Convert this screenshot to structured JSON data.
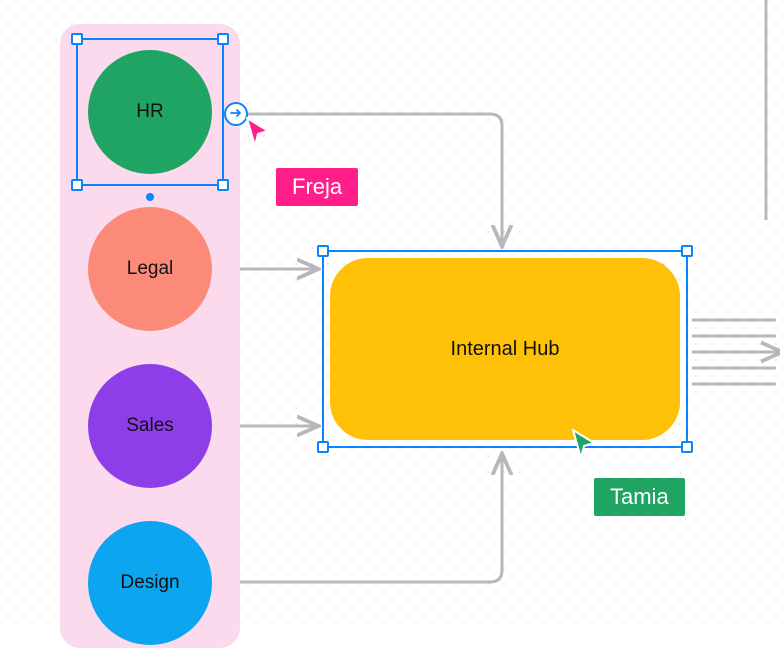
{
  "nodes": {
    "hr": {
      "label": "HR",
      "color": "#1FA463"
    },
    "legal": {
      "label": "Legal",
      "color": "#FC8A78"
    },
    "sales": {
      "label": "Sales",
      "color": "#8E3EE8"
    },
    "design": {
      "label": "Design",
      "color": "#0BA5F0"
    }
  },
  "hub": {
    "label": "Internal Hub",
    "color": "#FFC107"
  },
  "collaborators": {
    "freja": {
      "name": "Freja",
      "color": "#FF1E8A"
    },
    "tamia": {
      "name": "Tamia",
      "color": "#1FA463"
    }
  },
  "selection_color": "#0A84FF"
}
